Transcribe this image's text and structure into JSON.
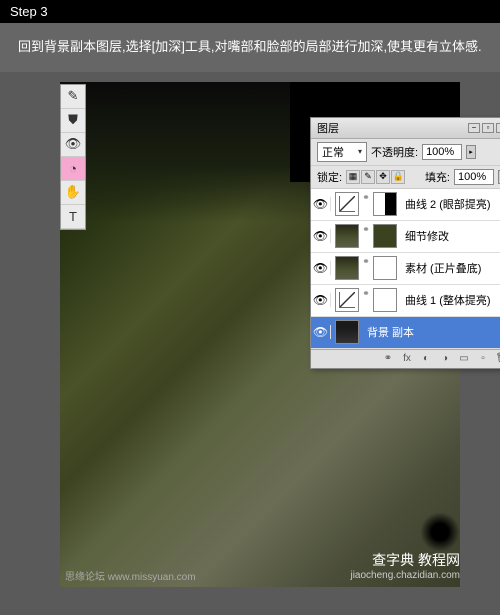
{
  "step": "Step 3",
  "instruction": "回到背景副本图层,选择[加深]工具,对嘴部和脸部的局部进行加深,使其更有立体感.",
  "tools": [
    {
      "icon": "✎",
      "name": "pencil-tool"
    },
    {
      "icon": "⛊",
      "name": "shape-tool"
    },
    {
      "icon": "👁",
      "name": "eye-tool"
    },
    {
      "icon": "◔",
      "name": "burn-tool",
      "active": true
    },
    {
      "icon": "✋",
      "name": "hand-tool"
    },
    {
      "icon": "T",
      "name": "type-tool"
    }
  ],
  "panel": {
    "title": "图层",
    "blend_mode": "正常",
    "opacity_label": "不透明度:",
    "opacity": "100%",
    "lock_label": "锁定:",
    "fill_label": "填充:",
    "fill": "100%",
    "layers": [
      {
        "eye": "👁",
        "type": "adjustment",
        "name": "曲线 2 (眼部提亮)"
      },
      {
        "eye": "👁",
        "type": "image-mask",
        "name": "细节修改"
      },
      {
        "eye": "👁",
        "type": "image-mask",
        "name": "素材 (正片叠底)"
      },
      {
        "eye": "👁",
        "type": "adjustment",
        "name": "曲线 1 (整体提亮)"
      },
      {
        "eye": "👁",
        "type": "background",
        "name": "背景 副本",
        "selected": true
      }
    ]
  },
  "watermark": {
    "left": "思缘论坛  www.missyuan.com",
    "right_main": "查字典 教程网",
    "right_sub": "jiaocheng.chazidian.com"
  }
}
